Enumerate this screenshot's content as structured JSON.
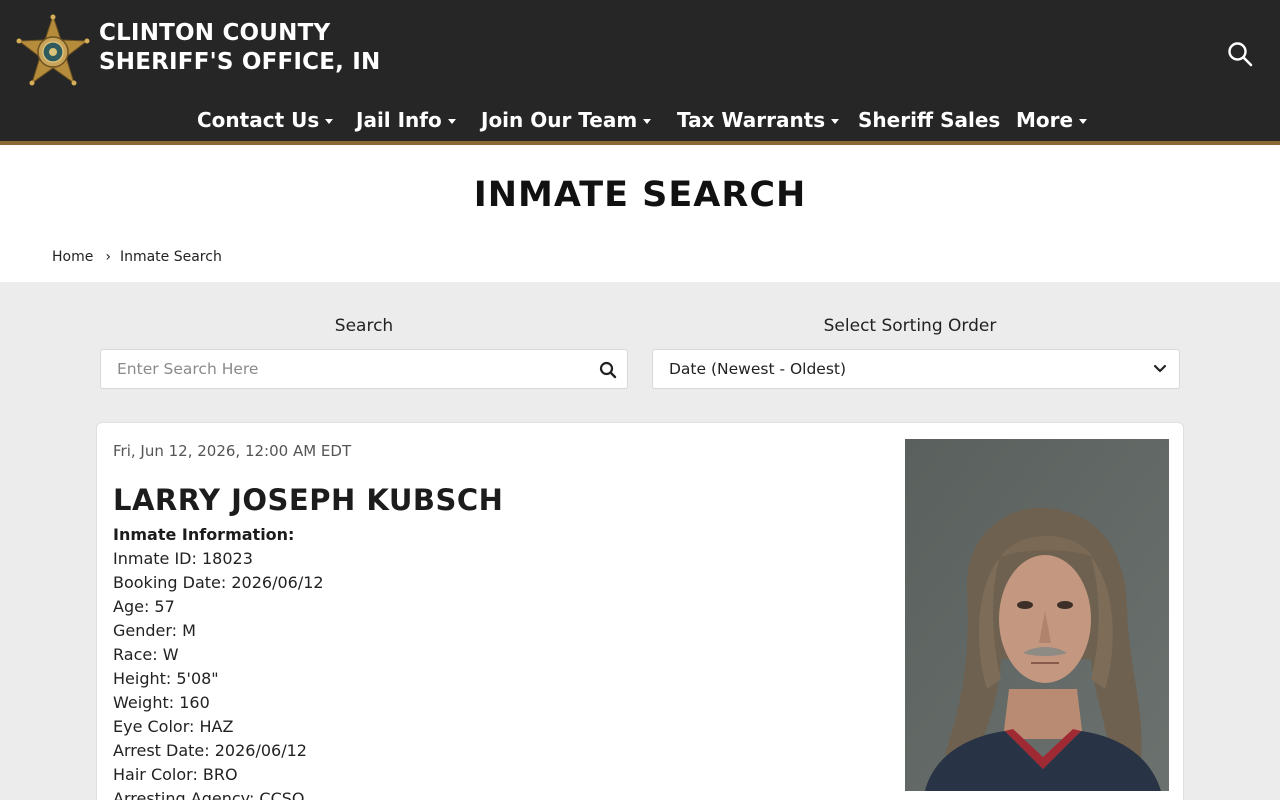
{
  "header": {
    "title_line1": "CLINTON COUNTY",
    "title_line2": "SHERIFF'S OFFICE, IN",
    "logo_icon": "sheriff-star-badge-icon",
    "search_icon": "search-icon",
    "colors": {
      "bar": "#262626",
      "accent": "#8c6a35"
    }
  },
  "nav": {
    "items": [
      {
        "label": "Contact Us",
        "has_dropdown": true
      },
      {
        "label": "Jail Info",
        "has_dropdown": true
      },
      {
        "label": "Join Our Team",
        "has_dropdown": true
      },
      {
        "label": "Tax Warrants",
        "has_dropdown": true
      },
      {
        "label": "Sheriff Sales",
        "has_dropdown": false
      },
      {
        "label": "More",
        "has_dropdown": true
      }
    ]
  },
  "page": {
    "title": "INMATE SEARCH",
    "breadcrumb": {
      "home": "Home",
      "separator": "›",
      "current": "Inmate Search"
    }
  },
  "search": {
    "label": "Search",
    "placeholder": "Enter Search Here",
    "icon": "search-icon"
  },
  "sort": {
    "label": "Select Sorting Order",
    "selected": "Date (Newest - Oldest)",
    "icon": "chevron-down-icon"
  },
  "inmate": {
    "timestamp": "Fri, Jun 12, 2026, 12:00 AM EDT",
    "name": "LARRY JOSEPH KUBSCH",
    "info_heading": "Inmate Information:",
    "fields": [
      "Inmate ID: 18023",
      "Booking Date: 2026/06/12",
      "Age: 57",
      "Gender: M",
      "Race: W",
      "Height: 5'08\"",
      "Weight: 160",
      "Eye Color: HAZ",
      "Arrest Date: 2026/06/12",
      "Hair Color: BRO",
      "Arresting Agency: CCSO"
    ],
    "photo_icon": "mugshot-photo"
  }
}
